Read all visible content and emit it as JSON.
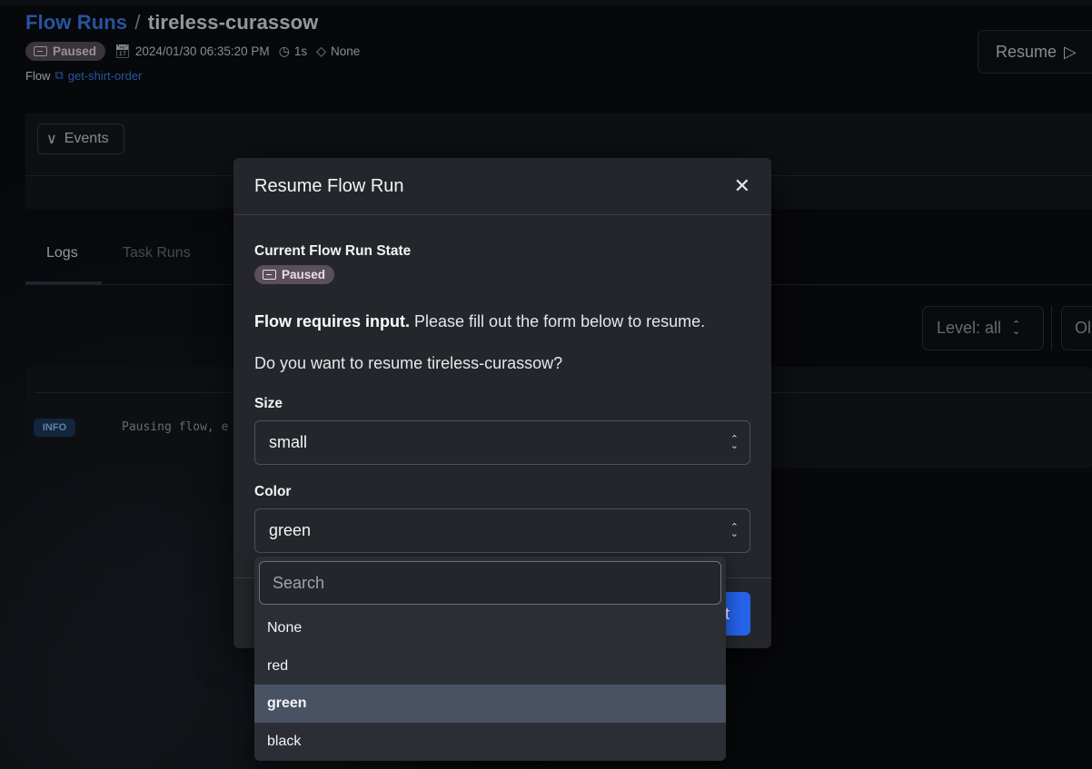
{
  "header": {
    "breadcrumb_root": "Flow Runs",
    "breadcrumb_sep": "/",
    "breadcrumb_current": "tireless-curassow",
    "state_badge": "Paused",
    "start_time": "2024/01/30 06:35:20 PM",
    "duration": "1s",
    "tags": "None",
    "flow_label": "Flow",
    "flow_name": "get-shirt-order",
    "resume_button": "Resume"
  },
  "panel": {
    "events_button": "Events",
    "tabs": [
      "Logs",
      "Task Runs"
    ],
    "level_select": "Level: all",
    "order_select": "Ol",
    "log_level": "INFO",
    "log_message": "Pausing flow, e"
  },
  "modal": {
    "title": "Resume Flow Run",
    "current_state_label": "Current Flow Run State",
    "current_state": "Paused",
    "requires_input_bold": "Flow requires input.",
    "requires_input_rest": " Please fill out the form below to resume.",
    "question": "Do you want to resume tireless-curassow?",
    "size_label": "Size",
    "size_value": "small",
    "color_label": "Color",
    "color_value": "green",
    "submit_partial": "t"
  },
  "dropdown": {
    "search_placeholder": "Search",
    "options": [
      "None",
      "red",
      "green",
      "black"
    ],
    "selected": "green"
  },
  "colors": {
    "accent": "#3b82f6",
    "primary_button": "#2563eb",
    "paused_badge": "#5a4f5a",
    "info_badge": "#1e3a5f",
    "selected_option": "#495263"
  }
}
